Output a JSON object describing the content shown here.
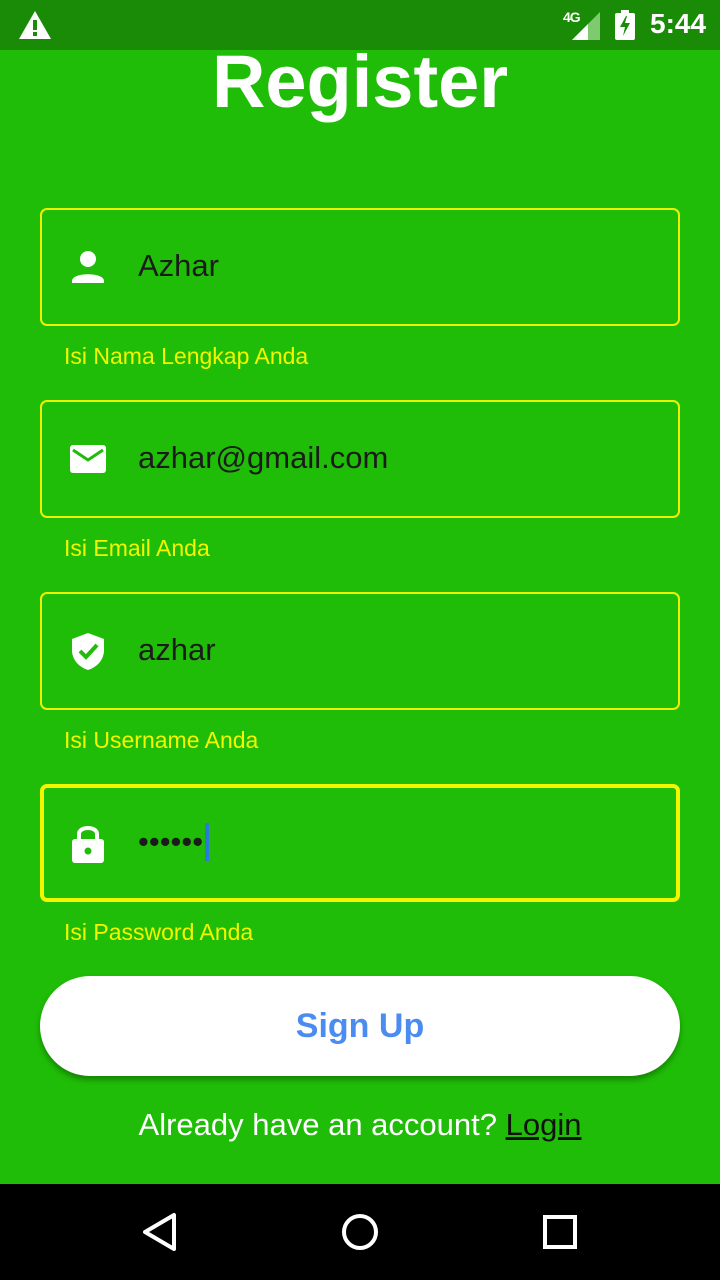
{
  "status_bar": {
    "network": "4G",
    "time": "5:44"
  },
  "title": "Register",
  "fields": [
    {
      "icon": "person-icon",
      "value": "Azhar",
      "helper": "Isi Nama Lengkap Anda"
    },
    {
      "icon": "mail-icon",
      "value": "azhar@gmail.com",
      "helper": "Isi Email Anda"
    },
    {
      "icon": "shield-check-icon",
      "value": "azhar",
      "helper": "Isi Username Anda"
    },
    {
      "icon": "lock-icon",
      "value": "••••••",
      "helper": "Isi Password Anda"
    }
  ],
  "signup_label": "Sign Up",
  "footer": {
    "prompt": "Already have an account?",
    "link": "Login"
  },
  "colors": {
    "background": "#1fbd07",
    "status_bar": "#1a8b07",
    "accent_yellow": "#f4f600",
    "button_text": "#4a8cf0"
  },
  "nav": {
    "back_icon": "back-triangle-icon",
    "home_icon": "home-circle-icon",
    "recents_icon": "recents-square-icon"
  }
}
